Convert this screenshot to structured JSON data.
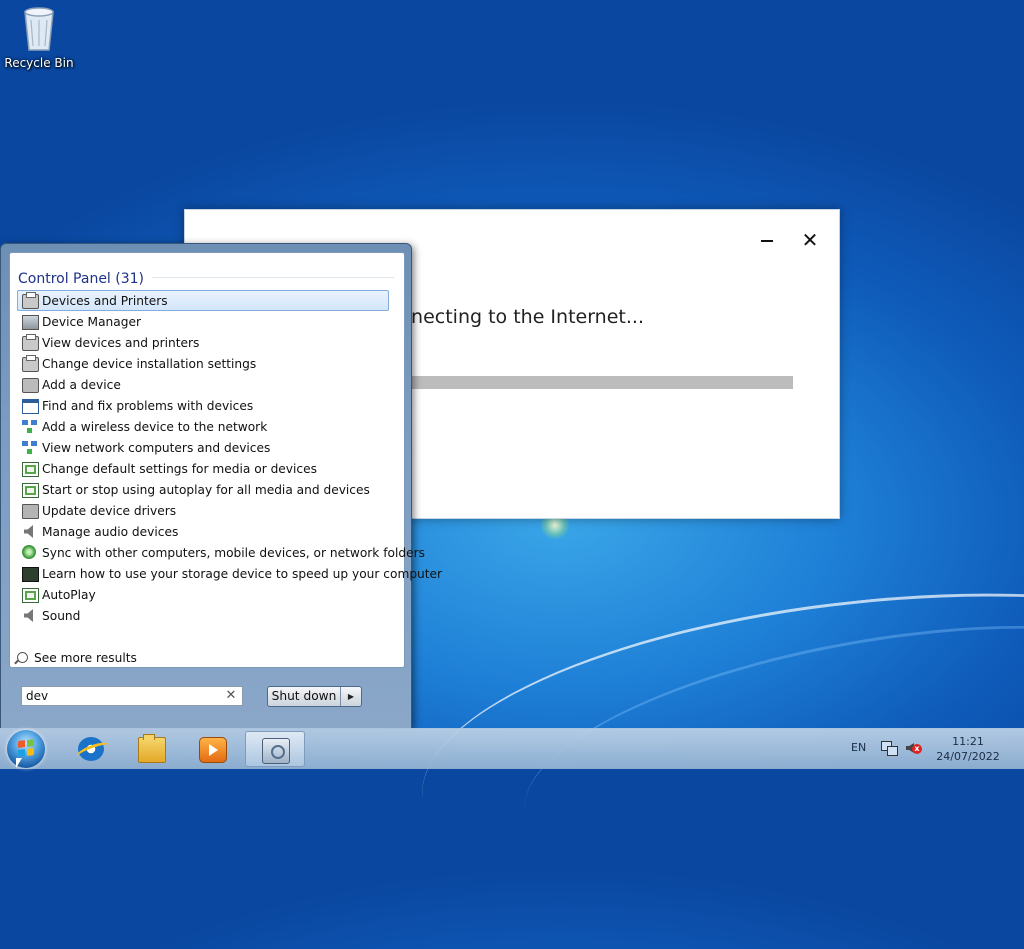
{
  "desktop": {
    "recycle_bin_label": "Recycle Bin"
  },
  "dialog": {
    "message": "nnecting to the Internet...",
    "minimize_glyph": "–",
    "close_glyph": "✕",
    "progress_fraction": 1.0
  },
  "start_menu": {
    "section_title": "Control Panel (31)",
    "results": [
      {
        "label": "Devices and Printers",
        "icon": "printer-icon",
        "selected": true
      },
      {
        "label": "Device Manager",
        "icon": "device-manager-icon"
      },
      {
        "label": "View devices and printers",
        "icon": "printer-icon"
      },
      {
        "label": "Change device installation settings",
        "icon": "printer-icon"
      },
      {
        "label": "Add a device",
        "icon": "add-device-icon"
      },
      {
        "label": "Find and fix problems with devices",
        "icon": "troubleshoot-icon"
      },
      {
        "label": "Add a wireless device to the network",
        "icon": "network-icon"
      },
      {
        "label": "View network computers and devices",
        "icon": "network-icon"
      },
      {
        "label": "Change default settings for media or devices",
        "icon": "autoplay-icon"
      },
      {
        "label": "Start or stop using autoplay for all media and devices",
        "icon": "autoplay-icon"
      },
      {
        "label": "Update device drivers",
        "icon": "driver-icon"
      },
      {
        "label": "Manage audio devices",
        "icon": "speaker-icon"
      },
      {
        "label": "Sync with other computers, mobile devices, or network folders",
        "icon": "sync-icon"
      },
      {
        "label": "Learn how to use your storage device to speed up your computer",
        "icon": "storage-icon"
      },
      {
        "label": "AutoPlay",
        "icon": "autoplay-icon"
      },
      {
        "label": "Sound",
        "icon": "speaker-icon"
      }
    ],
    "see_more": "See more results",
    "search_value": "dev",
    "clear_glyph": "✕",
    "shutdown_label": "Shut down",
    "shutdown_arrow": "▶"
  },
  "taskbar": {
    "language": "EN",
    "time": "11:21",
    "date": "24/07/2022",
    "volume_muted_glyph": "x"
  }
}
